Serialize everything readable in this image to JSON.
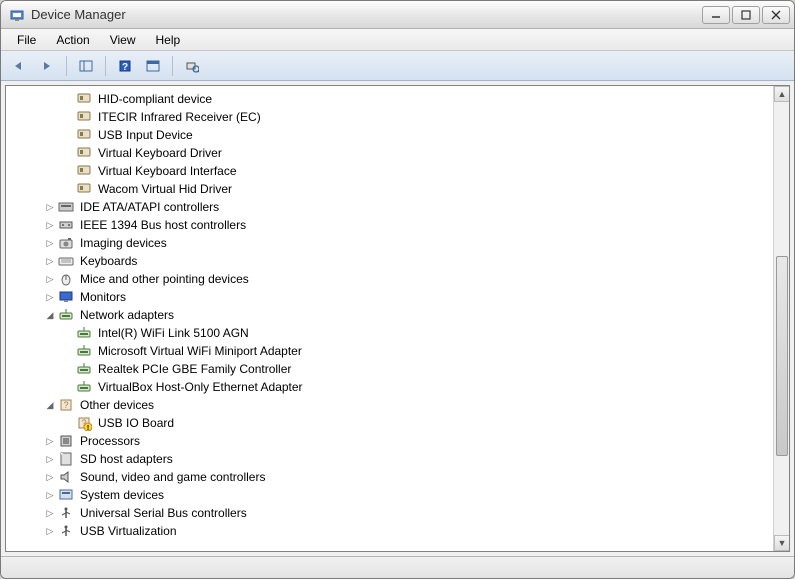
{
  "window": {
    "title": "Device Manager"
  },
  "menubar": {
    "items": [
      "File",
      "Action",
      "View",
      "Help"
    ]
  },
  "toolbar": {
    "back": "←",
    "forward": "→"
  },
  "tree": {
    "hid_children": [
      "HID-compliant device",
      "ITECIR Infrared Receiver (EC)",
      "USB Input Device",
      "Virtual Keyboard Driver",
      "Virtual Keyboard Interface",
      "Wacom Virtual Hid Driver"
    ],
    "categories": [
      {
        "label": "IDE ATA/ATAPI controllers",
        "icon": "ide"
      },
      {
        "label": "IEEE 1394 Bus host controllers",
        "icon": "1394"
      },
      {
        "label": "Imaging devices",
        "icon": "camera"
      },
      {
        "label": "Keyboards",
        "icon": "keyboard"
      },
      {
        "label": "Mice and other pointing devices",
        "icon": "mouse"
      },
      {
        "label": "Monitors",
        "icon": "monitor"
      }
    ],
    "network": {
      "label": "Network adapters",
      "children": [
        "Intel(R) WiFi Link 5100 AGN",
        "Microsoft Virtual WiFi Miniport Adapter",
        "Realtek PCIe GBE Family Controller",
        "VirtualBox Host-Only Ethernet Adapter"
      ]
    },
    "other": {
      "label": "Other devices",
      "children": [
        {
          "label": "USB IO Board",
          "warning": true
        }
      ]
    },
    "tail": [
      {
        "label": "Processors",
        "icon": "cpu"
      },
      {
        "label": "SD host adapters",
        "icon": "sd"
      },
      {
        "label": "Sound, video and game controllers",
        "icon": "sound"
      },
      {
        "label": "System devices",
        "icon": "system"
      },
      {
        "label": "Universal Serial Bus controllers",
        "icon": "usb"
      },
      {
        "label": "USB Virtualization",
        "icon": "usb"
      }
    ]
  }
}
